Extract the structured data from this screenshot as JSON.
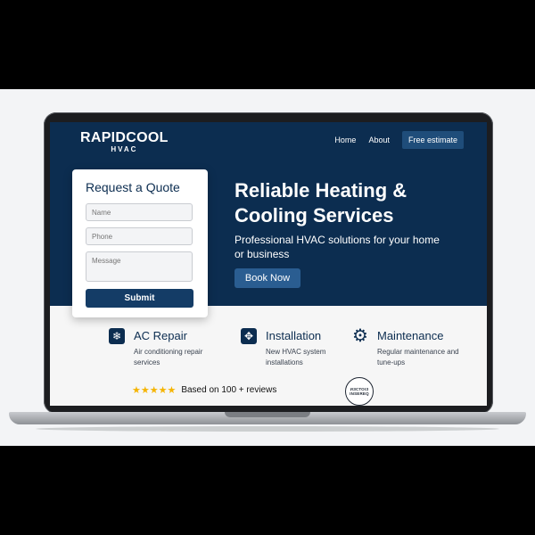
{
  "brand": {
    "name": "RAPIDCOOL",
    "subtitle": "HVAC"
  },
  "nav": {
    "home": "Home",
    "about": "About",
    "cta": "Free estimate"
  },
  "hero": {
    "headline": "Reliable Heating & Cooling Services",
    "subheadline": "Professional HVAC solutions for your home or business",
    "button": "Book Now"
  },
  "quote_form": {
    "title": "Request a Quote",
    "name_placeholder": "Name",
    "phone_placeholder": "Phone",
    "message_placeholder": "Message",
    "submit": "Submit"
  },
  "services": [
    {
      "icon": "snowflake-icon",
      "title": "AC Repair",
      "description": "Air conditioning repair services"
    },
    {
      "icon": "fan-icon",
      "title": "Installation",
      "description": "New HVAC system installations"
    },
    {
      "icon": "gear-icon",
      "title": "Maintenance",
      "description": "Regular maintenance and tune-ups"
    }
  ],
  "rating": {
    "stars": 5,
    "text": "Based on 100 + reviews"
  },
  "badge": {
    "text": "ИЗСТОІЗ INSEREQ"
  },
  "colors": {
    "navy": "#0c2d50",
    "button": "#2a5d91",
    "star": "#f5b400"
  }
}
